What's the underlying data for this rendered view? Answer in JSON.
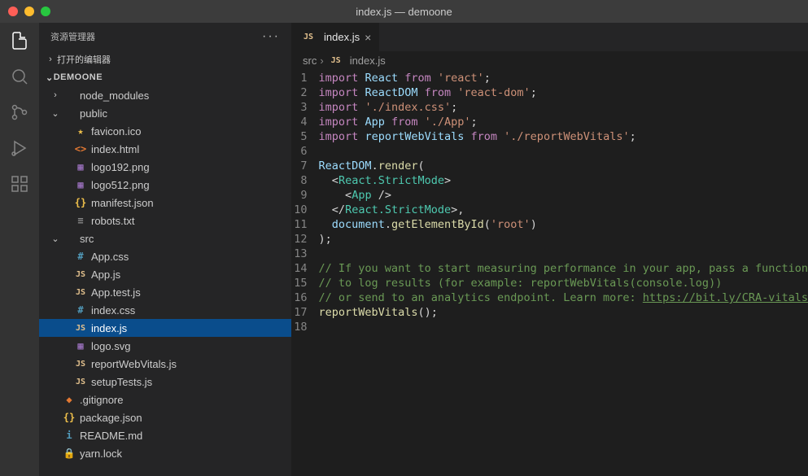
{
  "window_title": "index.js — demoone",
  "sidebar": {
    "title": "资源管理器",
    "open_editors": "打开的编辑器",
    "root": "DEMOONE"
  },
  "tree": [
    {
      "depth": 0,
      "chev": "›",
      "icon": "folder",
      "label": "node_modules"
    },
    {
      "depth": 0,
      "chev": "⌄",
      "icon": "folder",
      "label": "public"
    },
    {
      "depth": 1,
      "icon": "star",
      "label": "favicon.ico"
    },
    {
      "depth": 1,
      "icon": "html",
      "label": "index.html"
    },
    {
      "depth": 1,
      "icon": "img",
      "label": "logo192.png"
    },
    {
      "depth": 1,
      "icon": "img",
      "label": "logo512.png"
    },
    {
      "depth": 1,
      "icon": "json",
      "label": "manifest.json"
    },
    {
      "depth": 1,
      "icon": "txt",
      "label": "robots.txt"
    },
    {
      "depth": 0,
      "chev": "⌄",
      "icon": "folder",
      "label": "src"
    },
    {
      "depth": 1,
      "icon": "css",
      "label": "App.css"
    },
    {
      "depth": 1,
      "icon": "js",
      "label": "App.js"
    },
    {
      "depth": 1,
      "icon": "js",
      "label": "App.test.js"
    },
    {
      "depth": 1,
      "icon": "css",
      "label": "index.css"
    },
    {
      "depth": 1,
      "icon": "js",
      "label": "index.js",
      "selected": true
    },
    {
      "depth": 1,
      "icon": "svg",
      "label": "logo.svg"
    },
    {
      "depth": 1,
      "icon": "js",
      "label": "reportWebVitals.js"
    },
    {
      "depth": 1,
      "icon": "js",
      "label": "setupTests.js"
    },
    {
      "depth": 0,
      "icon": "git",
      "label": ".gitignore"
    },
    {
      "depth": 0,
      "icon": "json",
      "label": "package.json"
    },
    {
      "depth": 0,
      "icon": "md",
      "label": "README.md"
    },
    {
      "depth": 0,
      "icon": "lock",
      "label": "yarn.lock"
    }
  ],
  "tab": {
    "label": "index.js"
  },
  "breadcrumb": {
    "folder": "src",
    "file": "index.js"
  },
  "code_lines": 18,
  "code": {
    "l1": {
      "a": "import",
      "b": "React",
      "c": "from",
      "d": "'react'",
      "e": ";"
    },
    "l2": {
      "a": "import",
      "b": "ReactDOM",
      "c": "from",
      "d": "'react-dom'",
      "e": ";"
    },
    "l3": {
      "a": "import",
      "d": "'./index.css'",
      "e": ";"
    },
    "l4": {
      "a": "import",
      "b": "App",
      "c": "from",
      "d": "'./App'",
      "e": ";"
    },
    "l5": {
      "a": "import",
      "b": "reportWebVitals",
      "c": "from",
      "d": "'./reportWebVitals'",
      "e": ";"
    },
    "l7": {
      "a": "ReactDOM",
      "b": ".",
      "c": "render",
      "d": "("
    },
    "l8": {
      "a": "<",
      "b": "React.StrictMode",
      "c": ">"
    },
    "l9": {
      "a": "<",
      "b": "App",
      "c": " />"
    },
    "l10": {
      "a": "</",
      "b": "React.StrictMode",
      "c": ">,"
    },
    "l11": {
      "a": "document",
      "b": ".",
      "c": "getElementById",
      "d": "(",
      "e": "'root'",
      "f": ")"
    },
    "l12": {
      "a": ");"
    },
    "l14": {
      "a": "// If you want to start measuring performance in your app, pass a function"
    },
    "l15": {
      "a": "// to log results (for example: reportWebVitals(console.log))"
    },
    "l16": {
      "a": "// or send to an analytics endpoint. Learn more: ",
      "b": "https://bit.ly/CRA-vitals"
    },
    "l17": {
      "a": "reportWebVitals",
      "b": "();"
    }
  }
}
